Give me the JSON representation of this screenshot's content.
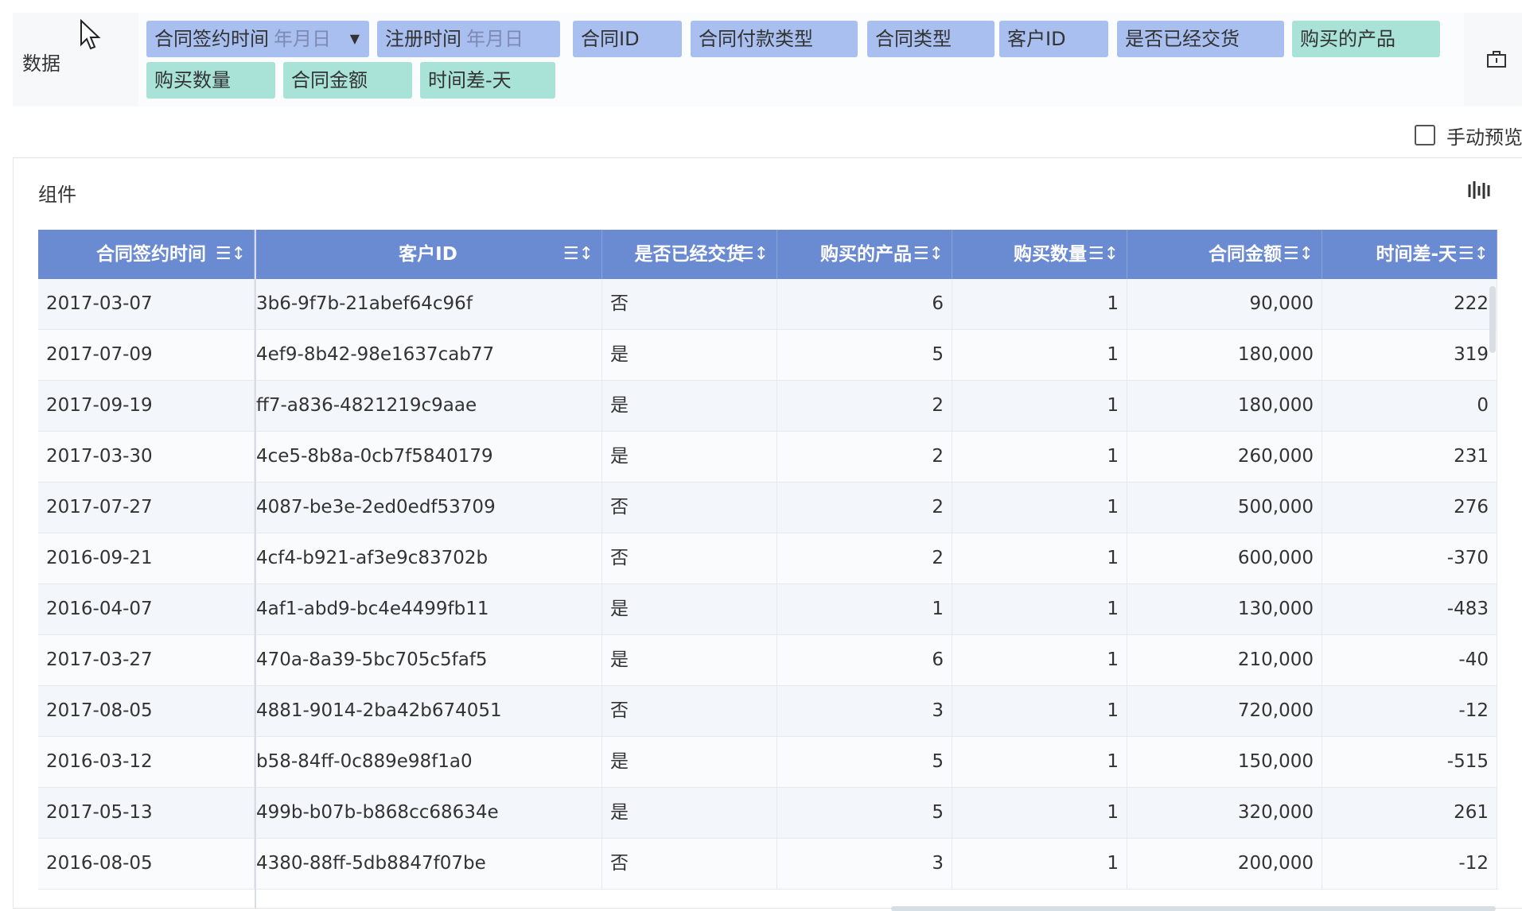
{
  "data_panel": {
    "label": "数据",
    "dimension_fields": [
      {
        "label": "合同签约时间",
        "placeholder": "年月日",
        "has_dropdown": true
      },
      {
        "label": "注册时间",
        "placeholder": "年月日",
        "has_dropdown": false
      },
      {
        "label": "合同ID"
      },
      {
        "label": "合同付款类型"
      },
      {
        "label": "合同类型"
      },
      {
        "label": "客户ID"
      },
      {
        "label": "是否已经交货"
      }
    ],
    "measure_fields": [
      {
        "label": "购买的产品"
      },
      {
        "label": "购买数量"
      },
      {
        "label": "合同金额"
      },
      {
        "label": "时间差-天"
      }
    ],
    "dimension_color": "#a8bff0",
    "measure_color": "#a9e2d6"
  },
  "manual_preview": {
    "label": "手动预览",
    "checked": false
  },
  "component_panel": {
    "label": "组件"
  },
  "table": {
    "header_color": "#6a8ad2",
    "columns": [
      "合同签约时间",
      "客户ID",
      "是否已经交货",
      "购买的产品",
      "购买数量",
      "合同金额",
      "时间差-天"
    ],
    "rows": [
      [
        "2017-03-07",
        "3b6-9f7b-21abef64c96f",
        "否",
        "6",
        "1",
        "90,000",
        "222"
      ],
      [
        "2017-07-09",
        "4ef9-8b42-98e1637cab77",
        "是",
        "5",
        "1",
        "180,000",
        "319"
      ],
      [
        "2017-09-19",
        "ff7-a836-4821219c9aae",
        "是",
        "2",
        "1",
        "180,000",
        "0"
      ],
      [
        "2017-03-30",
        "4ce5-8b8a-0cb7f5840179",
        "是",
        "2",
        "1",
        "260,000",
        "231"
      ],
      [
        "2017-07-27",
        "4087-be3e-2ed0edf53709",
        "否",
        "2",
        "1",
        "500,000",
        "276"
      ],
      [
        "2016-09-21",
        "4cf4-b921-af3e9c83702b",
        "否",
        "2",
        "1",
        "600,000",
        "-370"
      ],
      [
        "2016-04-07",
        "4af1-abd9-bc4e4499fb11",
        "是",
        "1",
        "1",
        "130,000",
        "-483"
      ],
      [
        "2017-03-27",
        "470a-8a39-5bc705c5faf5",
        "是",
        "6",
        "1",
        "210,000",
        "-40"
      ],
      [
        "2017-08-05",
        "4881-9014-2ba42b674051",
        "否",
        "3",
        "1",
        "720,000",
        "-12"
      ],
      [
        "2016-03-12",
        "b58-84ff-0c889e98f1a0",
        "是",
        "5",
        "1",
        "150,000",
        "-515"
      ],
      [
        "2017-05-13",
        "499b-b07b-b868cc68634e",
        "是",
        "5",
        "1",
        "320,000",
        "261"
      ],
      [
        "2016-08-05",
        "4380-88ff-5db8847f07be",
        "否",
        "3",
        "1",
        "200,000",
        "-12"
      ]
    ]
  }
}
